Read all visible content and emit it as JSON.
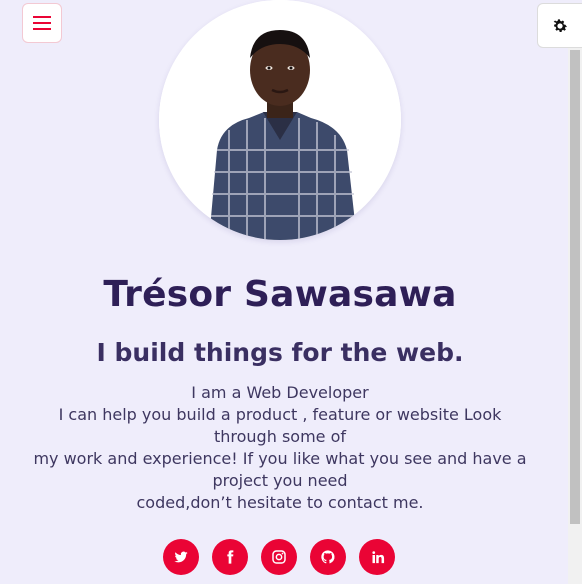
{
  "header": {
    "menu_icon": "hamburger-icon",
    "settings_icon": "gear-icon"
  },
  "profile": {
    "name": "Trésor Sawasawa",
    "tagline": "I build things for the web.",
    "bio_lines": [
      "I am a Web Developer",
      "I can help you build a product , feature or website Look through some of",
      "my work and experience! If you like what you see and have a project you need",
      "coded,don’t hesitate to contact me."
    ]
  },
  "socials": [
    {
      "name": "twitter",
      "icon": "twitter-icon"
    },
    {
      "name": "facebook",
      "icon": "facebook-icon"
    },
    {
      "name": "instagram",
      "icon": "instagram-icon"
    },
    {
      "name": "github",
      "icon": "github-icon"
    },
    {
      "name": "linkedin",
      "icon": "linkedin-icon"
    }
  ],
  "colors": {
    "background": "#efedfb",
    "accent": "#ea0435",
    "heading": "#2e1f57"
  }
}
